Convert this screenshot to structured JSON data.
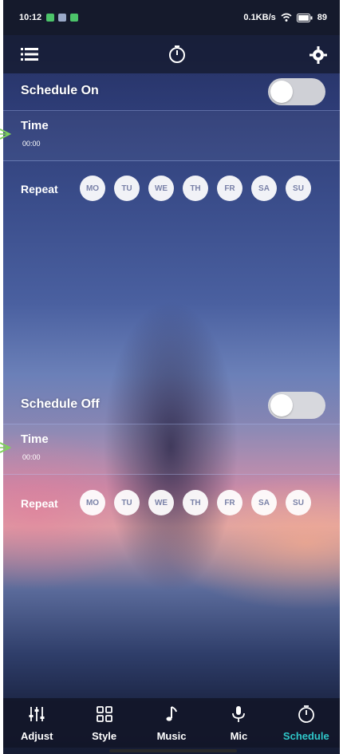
{
  "status_bar": {
    "time": "10:12",
    "network_speed": "0.1KB/s",
    "battery": "89"
  },
  "colors": {
    "accent": "#2fc7c9",
    "toggle_track": "#e1e1e1",
    "arrow": "#7fd35a"
  },
  "schedule_on": {
    "title": "Schedule On",
    "toggle_on": false,
    "time_label": "Time",
    "time_value": "00:00",
    "repeat_label": "Repeat",
    "days": [
      "MO",
      "TU",
      "WE",
      "TH",
      "FR",
      "SA",
      "SU"
    ]
  },
  "schedule_off": {
    "title": "Schedule Off",
    "toggle_on": false,
    "time_label": "Time",
    "time_value": "00:00",
    "repeat_label": "Repeat",
    "days": [
      "MO",
      "TU",
      "WE",
      "TH",
      "FR",
      "SA",
      "SU"
    ]
  },
  "bottom_nav": {
    "items": [
      {
        "label": "Adjust",
        "icon": "sliders-icon",
        "active": false
      },
      {
        "label": "Style",
        "icon": "grid-icon",
        "active": false
      },
      {
        "label": "Music",
        "icon": "music-note-icon",
        "active": false
      },
      {
        "label": "Mic",
        "icon": "microphone-icon",
        "active": false
      },
      {
        "label": "Schedule",
        "icon": "timer-icon",
        "active": true
      }
    ]
  }
}
